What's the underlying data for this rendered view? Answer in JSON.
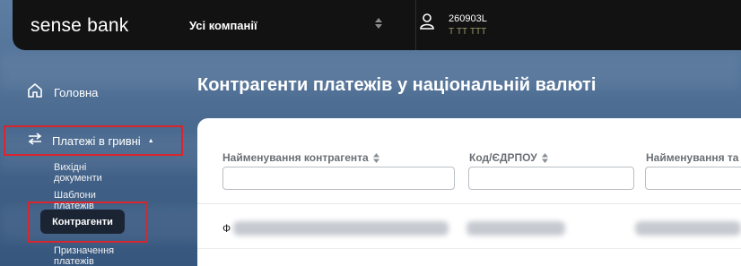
{
  "header": {
    "logo_text": "sense bank",
    "company_select": "Усі компанії",
    "user_id": "260903L",
    "user_name": "Т ТТ ТТТ"
  },
  "sidebar": {
    "home_label": "Головна",
    "payments_label": "Платежі в гривні",
    "sub_items": [
      {
        "label": "Вихідні документи",
        "active": false
      },
      {
        "label": "Шаблони платежів",
        "active": false
      },
      {
        "label": "Контрагенти",
        "active": true
      },
      {
        "label": "Призначення платежів",
        "active": false
      }
    ]
  },
  "main": {
    "title": "Контрагенти платежів у національній валюті",
    "columns": [
      {
        "label": "Найменування контрагента"
      },
      {
        "label": "Код/ЄДРПОУ"
      },
      {
        "label": "Найменування та"
      }
    ],
    "filters": [
      {
        "value": "",
        "placeholder": ""
      },
      {
        "value": "",
        "placeholder": ""
      },
      {
        "value": "",
        "placeholder": ""
      }
    ],
    "rows": [
      {
        "first_char": "Ф"
      }
    ]
  },
  "colors": {
    "topbar": "#121212",
    "highlight_border": "#d8262f",
    "active_pill": "#1b2433",
    "card": "#ffffff",
    "column_header_text": "#6b6f75"
  }
}
